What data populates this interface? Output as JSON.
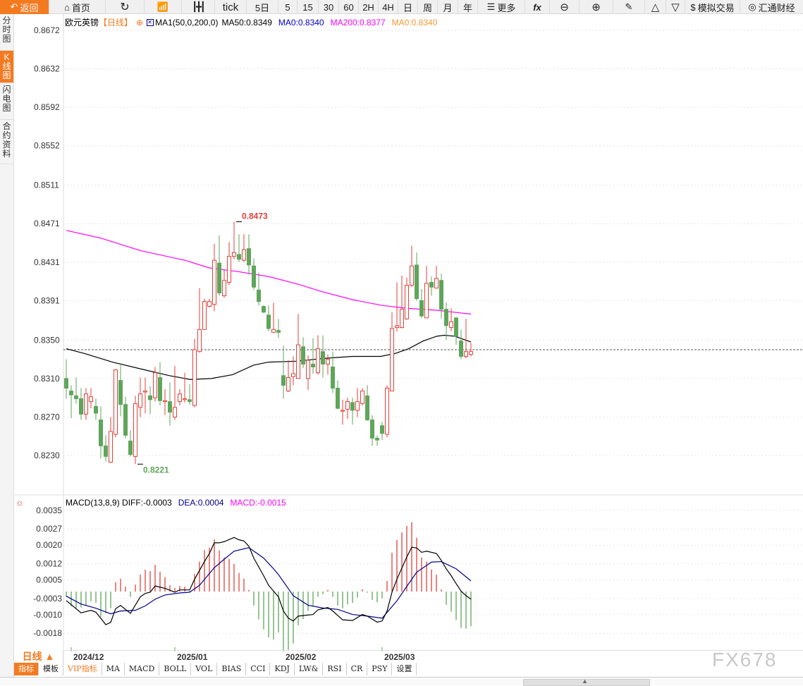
{
  "toolbar": {
    "back": "返回",
    "home": "首页",
    "tick": "tick",
    "d5": "5日",
    "m5": "5",
    "m15": "15",
    "m30": "30",
    "m60": "60",
    "h2": "2H",
    "h4": "4H",
    "day": "日",
    "week": "周",
    "month": "月",
    "year": "年",
    "more": "更多",
    "fx": "fx",
    "sim_trade": "模拟交易",
    "brand": "汇通财经"
  },
  "sidebar": {
    "tabs": [
      "分时图",
      "K线图",
      "闪电图",
      "合约资料"
    ]
  },
  "legend": {
    "symbol": "欧元英镑",
    "period": "【日线】",
    "ma_set": "MA1(50,0,200,0)",
    "ma50": "MA50:0.8349",
    "ma0a": "MA0:0.8340",
    "ma200": "MA200:0.8377",
    "ma0b": "MA0:0.8340"
  },
  "macd_legend": {
    "name": "MACD(13,8,9) DIFF:-0.0003",
    "dea": "DEA:0.0004",
    "macd": "MACD:-0.0015"
  },
  "colors": {
    "up": "#e0413a",
    "down": "#5fa55a",
    "ma50": "#000000",
    "ma200": "#ff00ff",
    "dea": "#00008b",
    "accent": "#f47a20"
  },
  "bottom": {
    "period": "日线 ▲",
    "tabs": [
      "指标",
      "模板",
      "VIP指标",
      "MA",
      "MACD",
      "BOLL",
      "VOL",
      "BIAS",
      "CCI",
      "KDJ",
      "LW&",
      "RSI",
      "CR",
      "PSY",
      "设置"
    ]
  },
  "watermark": "FX678",
  "chart_data": [
    {
      "type": "candlestick",
      "title": "欧元英镑 日线",
      "ylim": [
        0.821,
        0.869
      ],
      "yticks": [
        "0.8672",
        "0.8632",
        "0.8592",
        "0.8552",
        "0.8511",
        "0.8471",
        "0.8431",
        "0.8391",
        "0.8350",
        "0.8310",
        "0.8270",
        "0.8230"
      ],
      "xticks": [
        {
          "label": "2024/12",
          "index": 1
        },
        {
          "label": "2025/01",
          "index": 22
        },
        {
          "label": "2025/02",
          "index": 44
        },
        {
          "label": "2025/03",
          "index": 64
        }
      ],
      "last_price": 0.834,
      "annotations": [
        {
          "text": "0.8473",
          "index": 35,
          "price": 0.8473,
          "kind": "high"
        },
        {
          "text": "0.8221",
          "index": 15,
          "price": 0.8221,
          "kind": "low"
        }
      ],
      "ohlc": [
        [
          0.831,
          0.833,
          0.8289,
          0.83
        ],
        [
          0.8297,
          0.8303,
          0.8269,
          0.8293
        ],
        [
          0.8292,
          0.8311,
          0.8284,
          0.8289
        ],
        [
          0.8289,
          0.83,
          0.8267,
          0.8273
        ],
        [
          0.8273,
          0.83,
          0.8267,
          0.8294
        ],
        [
          0.8286,
          0.83,
          0.8279,
          0.8291
        ],
        [
          0.8281,
          0.8289,
          0.8267,
          0.8274
        ],
        [
          0.8267,
          0.8281,
          0.8227,
          0.824
        ],
        [
          0.824,
          0.8251,
          0.8224,
          0.8229
        ],
        [
          0.8223,
          0.827,
          0.8222,
          0.8255
        ],
        [
          0.8252,
          0.832,
          0.8249,
          0.8319
        ],
        [
          0.8308,
          0.8324,
          0.8271,
          0.8283
        ],
        [
          0.8283,
          0.8291,
          0.8248,
          0.8251
        ],
        [
          0.8245,
          0.8256,
          0.8229,
          0.8231
        ],
        [
          0.8229,
          0.8292,
          0.8221,
          0.8284
        ],
        [
          0.828,
          0.8311,
          0.827,
          0.8294
        ],
        [
          0.8296,
          0.8311,
          0.8274,
          0.8297
        ],
        [
          0.8292,
          0.8302,
          0.8273,
          0.8288
        ],
        [
          0.829,
          0.8322,
          0.8286,
          0.8316
        ],
        [
          0.8311,
          0.8327,
          0.8282,
          0.8287
        ],
        [
          0.8286,
          0.8299,
          0.8272,
          0.8287
        ],
        [
          0.8286,
          0.8306,
          0.8261,
          0.8275
        ],
        [
          0.827,
          0.8323,
          0.8267,
          0.828
        ],
        [
          0.8286,
          0.8299,
          0.8282,
          0.8294
        ],
        [
          0.8288,
          0.8316,
          0.8285,
          0.8289
        ],
        [
          0.8288,
          0.8304,
          0.8283,
          0.8286
        ],
        [
          0.8282,
          0.8351,
          0.828,
          0.834
        ],
        [
          0.8338,
          0.8404,
          0.8337,
          0.8361
        ],
        [
          0.8361,
          0.8393,
          0.8361,
          0.839
        ],
        [
          0.8385,
          0.8393,
          0.8384,
          0.839
        ],
        [
          0.8387,
          0.845,
          0.838,
          0.8433
        ],
        [
          0.843,
          0.8459,
          0.8396,
          0.8399
        ],
        [
          0.8396,
          0.8423,
          0.8394,
          0.8412
        ],
        [
          0.841,
          0.8452,
          0.8407,
          0.8437
        ],
        [
          0.8437,
          0.8473,
          0.8434,
          0.8441
        ],
        [
          0.8439,
          0.846,
          0.8431,
          0.8434
        ],
        [
          0.8433,
          0.846,
          0.8431,
          0.8444
        ],
        [
          0.8445,
          0.846,
          0.8418,
          0.8428
        ],
        [
          0.8427,
          0.8435,
          0.8402,
          0.8405
        ],
        [
          0.8402,
          0.842,
          0.8386,
          0.839
        ],
        [
          0.8385,
          0.8386,
          0.8378,
          0.8379
        ],
        [
          0.8376,
          0.8386,
          0.8359,
          0.8362
        ],
        [
          0.8358,
          0.8389,
          0.8358,
          0.8361
        ],
        [
          0.836,
          0.8372,
          0.8352,
          0.8358
        ],
        [
          0.8313,
          0.8344,
          0.8289,
          0.8303
        ],
        [
          0.8297,
          0.8329,
          0.8296,
          0.8311
        ],
        [
          0.8312,
          0.8333,
          0.8303,
          0.8315
        ],
        [
          0.831,
          0.8377,
          0.831,
          0.8345
        ],
        [
          0.8343,
          0.8353,
          0.8321,
          0.8325
        ],
        [
          0.831,
          0.8334,
          0.8298,
          0.8329
        ],
        [
          0.8325,
          0.8352,
          0.8315,
          0.8322
        ],
        [
          0.8316,
          0.8355,
          0.8314,
          0.8341
        ],
        [
          0.8338,
          0.8355,
          0.8311,
          0.8325
        ],
        [
          0.8325,
          0.8335,
          0.8314,
          0.833
        ],
        [
          0.8322,
          0.8338,
          0.8295,
          0.83
        ],
        [
          0.83,
          0.8308,
          0.8278,
          0.8279
        ],
        [
          0.8276,
          0.8288,
          0.8262,
          0.8277
        ],
        [
          0.8278,
          0.829,
          0.8268,
          0.8286
        ],
        [
          0.8285,
          0.829,
          0.8262,
          0.8277
        ],
        [
          0.8277,
          0.83,
          0.827,
          0.8286
        ],
        [
          0.8284,
          0.83,
          0.8282,
          0.8297
        ],
        [
          0.8292,
          0.8303,
          0.8266,
          0.8267
        ],
        [
          0.8267,
          0.8272,
          0.824,
          0.8248
        ],
        [
          0.8248,
          0.8251,
          0.824,
          0.8246
        ],
        [
          0.8261,
          0.8265,
          0.8246,
          0.8253
        ],
        [
          0.8252,
          0.8303,
          0.8249,
          0.83
        ],
        [
          0.8297,
          0.8379,
          0.8297,
          0.8362
        ],
        [
          0.8363,
          0.841,
          0.8359,
          0.8365
        ],
        [
          0.8363,
          0.8417,
          0.8362,
          0.8382
        ],
        [
          0.8372,
          0.8415,
          0.8371,
          0.8407
        ],
        [
          0.8407,
          0.8448,
          0.8405,
          0.8427
        ],
        [
          0.8428,
          0.8441,
          0.8391,
          0.8393
        ],
        [
          0.8391,
          0.8403,
          0.8373,
          0.8375
        ],
        [
          0.8373,
          0.8427,
          0.8373,
          0.8409
        ],
        [
          0.841,
          0.8416,
          0.8396,
          0.8405
        ],
        [
          0.8404,
          0.8427,
          0.8404,
          0.8414
        ],
        [
          0.8412,
          0.8419,
          0.8372,
          0.8382
        ],
        [
          0.8382,
          0.8389,
          0.835,
          0.8365
        ],
        [
          0.8363,
          0.8383,
          0.8359,
          0.8369
        ],
        [
          0.8373,
          0.8374,
          0.8345,
          0.8354
        ],
        [
          0.8349,
          0.8361,
          0.833,
          0.8333
        ],
        [
          0.8333,
          0.8372,
          0.8331,
          0.8338
        ],
        [
          0.8335,
          0.8347,
          0.8333,
          0.8338
        ]
      ],
      "ma50": [
        [
          0,
          0.8341
        ],
        [
          3.7,
          0.8336
        ],
        [
          9.4,
          0.8327
        ],
        [
          15.1,
          0.832
        ],
        [
          20.9,
          0.8313
        ],
        [
          25.1,
          0.8309
        ],
        [
          29.4,
          0.831
        ],
        [
          33.7,
          0.8314
        ],
        [
          38,
          0.8324
        ],
        [
          40.9,
          0.8327
        ],
        [
          46.6,
          0.8328
        ],
        [
          52.3,
          0.8331
        ],
        [
          58,
          0.8333
        ],
        [
          63.7,
          0.8333
        ],
        [
          66.6,
          0.8336
        ],
        [
          69.4,
          0.8341
        ],
        [
          72.3,
          0.8349
        ],
        [
          75.1,
          0.8354
        ],
        [
          76.6,
          0.8355
        ],
        [
          78.7,
          0.8354
        ],
        [
          82,
          0.8348
        ]
      ],
      "ma200": [
        [
          0,
          0.8464
        ],
        [
          7,
          0.8456
        ],
        [
          15,
          0.8443
        ],
        [
          24,
          0.8433
        ],
        [
          29,
          0.8425
        ],
        [
          35,
          0.8421
        ],
        [
          41,
          0.8416
        ],
        [
          47,
          0.8408
        ],
        [
          52,
          0.84
        ],
        [
          58,
          0.8392
        ],
        [
          64,
          0.8386
        ],
        [
          69,
          0.8383
        ],
        [
          75,
          0.8381
        ],
        [
          82,
          0.8377
        ]
      ]
    },
    {
      "type": "macd",
      "ylim": [
        -0.0026,
        0.0038
      ],
      "yticks": [
        "0.0035",
        "0.0027",
        "0.0020",
        "0.0012",
        "0.0005",
        "-0.0003",
        "-0.0010",
        "-0.0018"
      ],
      "histogram": [
        -0.00023,
        -0.00064,
        -0.00073,
        -0.00069,
        -0.00058,
        -0.00042,
        -0.00049,
        -0.00109,
        -0.00094,
        -0.00072,
        0.0004,
        0.00055,
        0.00021,
        -0.00023,
        0.0003,
        0.00073,
        0.00094,
        0.00088,
        0.00115,
        0.00085,
        0.00062,
        0.00027,
        0.00015,
        0.00024,
        0.00021,
        3e-05,
        0.00076,
        0.00129,
        0.00179,
        0.00189,
        0.00225,
        0.00177,
        0.00147,
        0.00141,
        0.00119,
        0.0008,
        0.00056,
        7e-05,
        -0.00061,
        -0.00119,
        -0.00163,
        -0.00198,
        -0.00207,
        -0.00176,
        -0.00251,
        -0.00251,
        -0.00224,
        -0.00146,
        -0.00119,
        -0.00084,
        -0.00064,
        -0.00023,
        -0.00012,
        7e-05,
        -0.00023,
        -0.00061,
        -0.00072,
        -0.00055,
        -0.00049,
        -0.00026,
        9e-05,
        -5e-05,
        -0.00036,
        -0.00046,
        -0.0003,
        0.00046,
        0.00167,
        0.00222,
        0.00255,
        0.00283,
        0.00299,
        0.00232,
        0.00147,
        0.00129,
        0.00095,
        0.00073,
        9e-05,
        -0.00057,
        -0.00087,
        -0.00122,
        -0.00157,
        -0.0016,
        -0.00149
      ],
      "diff": [
        [
          0,
          -0.00039
        ],
        [
          3,
          -0.00092
        ],
        [
          5,
          -0.00081
        ],
        [
          6,
          -0.00089
        ],
        [
          8,
          -0.00143
        ],
        [
          9,
          -0.00133
        ],
        [
          10,
          -0.00074
        ],
        [
          11,
          -0.0006
        ],
        [
          13,
          -0.00094
        ],
        [
          15,
          -0.00023
        ],
        [
          16,
          -8e-05
        ],
        [
          17,
          -3e-05
        ],
        [
          18,
          0.00024
        ],
        [
          20,
          0.00014
        ],
        [
          22,
          -3e-05
        ],
        [
          23,
          7e-05
        ],
        [
          25,
          7e-05
        ],
        [
          26,
          0.00053
        ],
        [
          28,
          0.00129
        ],
        [
          29,
          0.00164
        ],
        [
          30,
          0.0021
        ],
        [
          31,
          0.0021
        ],
        [
          32,
          0.00215
        ],
        [
          34,
          0.00233
        ],
        [
          35,
          0.00223
        ],
        [
          36,
          0.00218
        ],
        [
          37,
          0.00195
        ],
        [
          38,
          0.00144
        ],
        [
          40,
          0.00068
        ],
        [
          41,
          0.00027
        ],
        [
          43,
          -0.00023
        ],
        [
          44,
          -0.00084
        ],
        [
          45,
          -0.00115
        ],
        [
          46,
          -0.00127
        ],
        [
          47,
          -0.00106
        ],
        [
          50,
          -0.00099
        ],
        [
          51,
          -0.00079
        ],
        [
          53,
          -0.00069
        ],
        [
          54,
          -0.00084
        ],
        [
          56,
          -0.00122
        ],
        [
          58,
          -0.00125
        ],
        [
          60,
          -0.00099
        ],
        [
          61,
          -0.00106
        ],
        [
          63,
          -0.00132
        ],
        [
          64,
          -0.00127
        ],
        [
          65,
          -0.00084
        ],
        [
          66,
          -3e-05
        ],
        [
          67,
          0.00053
        ],
        [
          69,
          0.00149
        ],
        [
          70,
          0.00191
        ],
        [
          71,
          0.00188
        ],
        [
          72,
          0.00169
        ],
        [
          73,
          0.00174
        ],
        [
          75,
          0.00164
        ],
        [
          76,
          0.00134
        ],
        [
          77,
          0.00098
        ],
        [
          78,
          0.00068
        ],
        [
          79,
          0.00034
        ],
        [
          80,
          2e-05
        ],
        [
          81,
          -0.00018
        ],
        [
          82,
          -0.00033
        ]
      ],
      "dea": [
        [
          0,
          -0.0002
        ],
        [
          3,
          -0.00054
        ],
        [
          6,
          -0.00072
        ],
        [
          9,
          -0.00096
        ],
        [
          11,
          -0.00084
        ],
        [
          14,
          -0.00081
        ],
        [
          16,
          -0.00062
        ],
        [
          18,
          -0.00033
        ],
        [
          20,
          -0.00015
        ],
        [
          23,
          -6e-05
        ],
        [
          25,
          -3e-05
        ],
        [
          27,
          0.00027
        ],
        [
          30,
          0.00103
        ],
        [
          32,
          0.00139
        ],
        [
          34,
          0.00174
        ],
        [
          37,
          0.00189
        ],
        [
          40,
          0.00144
        ],
        [
          42,
          0.00098
        ],
        [
          43,
          0.00073
        ],
        [
          46,
          -0.00018
        ],
        [
          49,
          -0.00059
        ],
        [
          52,
          -0.00071
        ],
        [
          55,
          -0.00077
        ],
        [
          58,
          -0.00099
        ],
        [
          61,
          -0.00106
        ],
        [
          64,
          -0.00115
        ],
        [
          67,
          -0.0004
        ],
        [
          69,
          0.00022
        ],
        [
          71,
          0.00083
        ],
        [
          74,
          0.00127
        ],
        [
          76,
          0.00129
        ],
        [
          79,
          0.00098
        ],
        [
          82,
          0.00046
        ]
      ]
    }
  ]
}
